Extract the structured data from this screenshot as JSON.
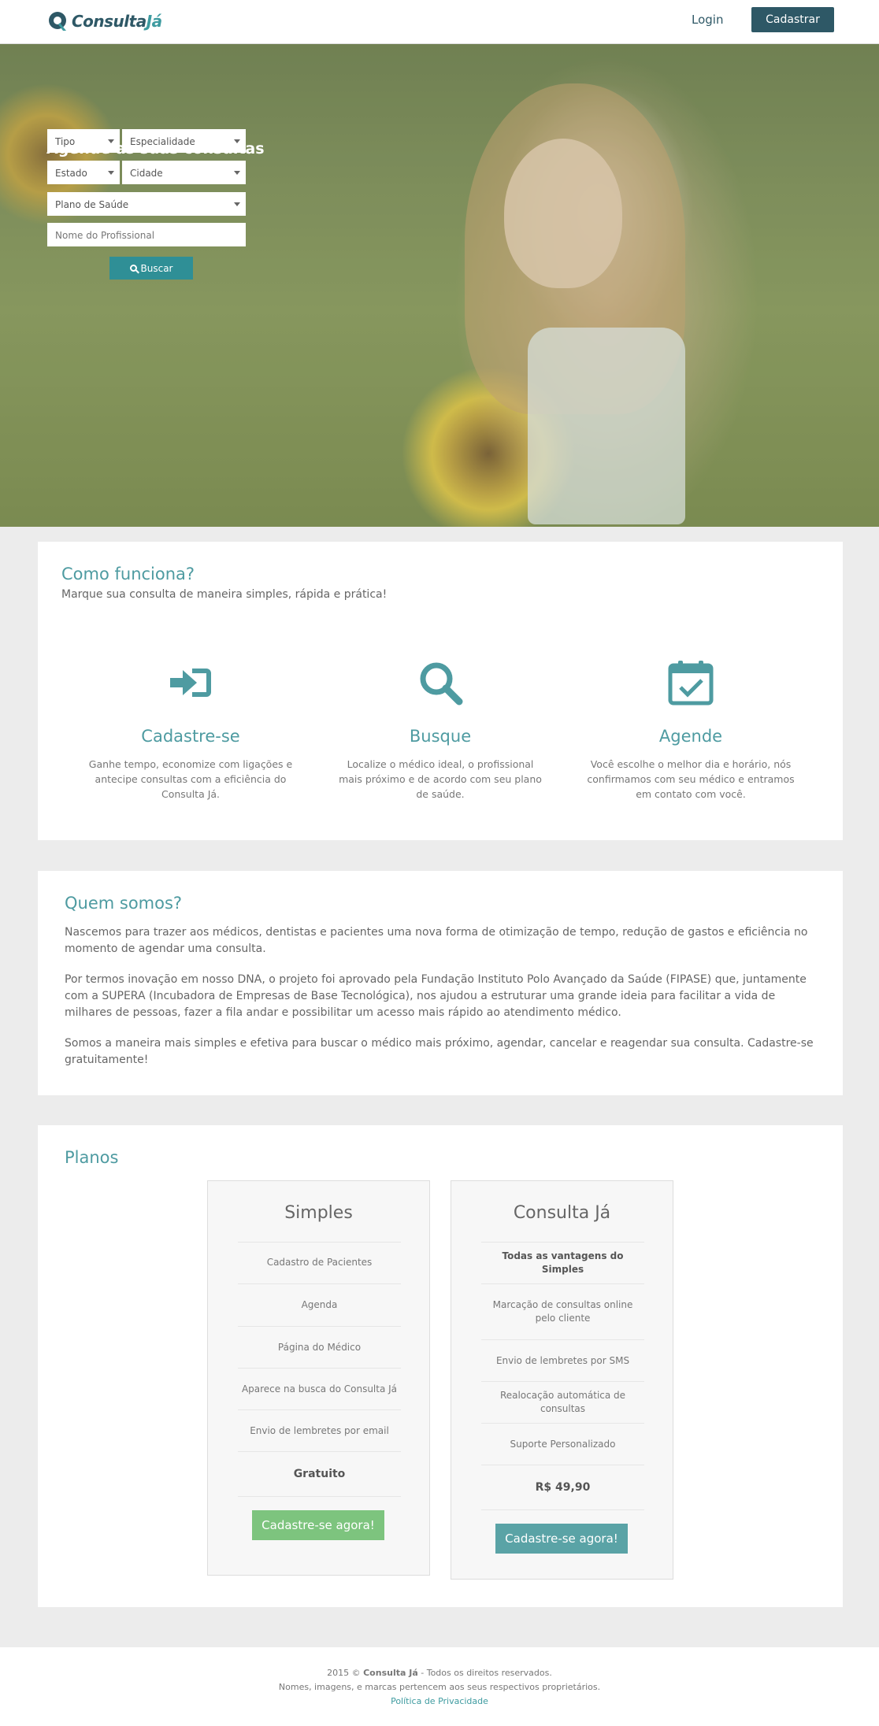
{
  "header": {
    "logo_main": "Consulta",
    "logo_accent": "Já",
    "login": "Login",
    "signup": "Cadastrar"
  },
  "hero": {
    "title": "Agende as suas consultas",
    "fields": {
      "tipo": "Tipo",
      "especialidade": "Especialidade",
      "estado": "Estado",
      "cidade": "Cidade",
      "plano": "Plano de Saúde",
      "nome_placeholder": "Nome do Profissional"
    },
    "search_button": "Buscar"
  },
  "how": {
    "title": "Como funciona?",
    "subtitle": "Marque sua consulta de maneira simples, rápida e prática!",
    "steps": [
      {
        "icon": "sign-in-icon",
        "title": "Cadastre-se",
        "text": "Ganhe tempo, economize com ligações e antecipe consultas com a eficiência do Consulta Já."
      },
      {
        "icon": "search-icon",
        "title": "Busque",
        "text": "Localize o médico ideal, o profissional mais próximo e de acordo com seu plano de saúde."
      },
      {
        "icon": "calendar-check-icon",
        "title": "Agende",
        "text": "Você escolhe o melhor dia e horário, nós confirmamos com seu médico e entramos em contato com você."
      }
    ]
  },
  "about": {
    "title": "Quem somos?",
    "paragraphs": [
      "Nascemos para trazer aos médicos, dentistas e pacientes uma nova forma de otimização de tempo, redução de gastos e eficiência no momento de agendar uma consulta.",
      "Por termos inovação em nosso DNA, o projeto foi aprovado pela Fundação Instituto Polo Avançado da Saúde (FIPASE) que, juntamente com a SUPERA (Incubadora de Empresas de Base Tecnológica), nos ajudou a estruturar uma grande ideia para facilitar a vida de milhares de pessoas, fazer a fila andar e possibilitar um acesso mais rápido ao atendimento médico.",
      "Somos a maneira mais simples e efetiva para buscar o médico mais próximo, agendar, cancelar e reagendar sua consulta. Cadastre-se gratuitamente!"
    ]
  },
  "plans": {
    "title": "Planos",
    "items": [
      {
        "name": "Simples",
        "features": [
          "Cadastro de Pacientes",
          "Agenda",
          "Página do Médico",
          "Aparece na busca do Consulta Já",
          "Envio de lembretes por email"
        ],
        "price": "Gratuito",
        "button": "Cadastre-se agora!",
        "button_color": "#7dc47e"
      },
      {
        "name": "Consulta Já",
        "features": [
          "Todas as vantagens do Simples",
          "Marcação de consultas online pelo cliente",
          "Envio de lembretes por SMS",
          "Realocação automática de consultas",
          "Suporte Personalizado"
        ],
        "price": "R$ 49,90",
        "button": "Cadastre-se agora!",
        "button_color": "#5aa3a6"
      }
    ]
  },
  "footer": {
    "year": "2015 ©",
    "brand": "Consulta Já",
    "rights": "- Todos os direitos reservados.",
    "line2": "Nomes, imagens, e marcas pertencem aos seus respectivos proprietários.",
    "privacy": "Política de Privacidade"
  },
  "colors": {
    "primary_dark": "#2e5866",
    "accent": "#4e9ba1",
    "green_button": "#7dc47e",
    "teal_button": "#5aa3a6"
  }
}
